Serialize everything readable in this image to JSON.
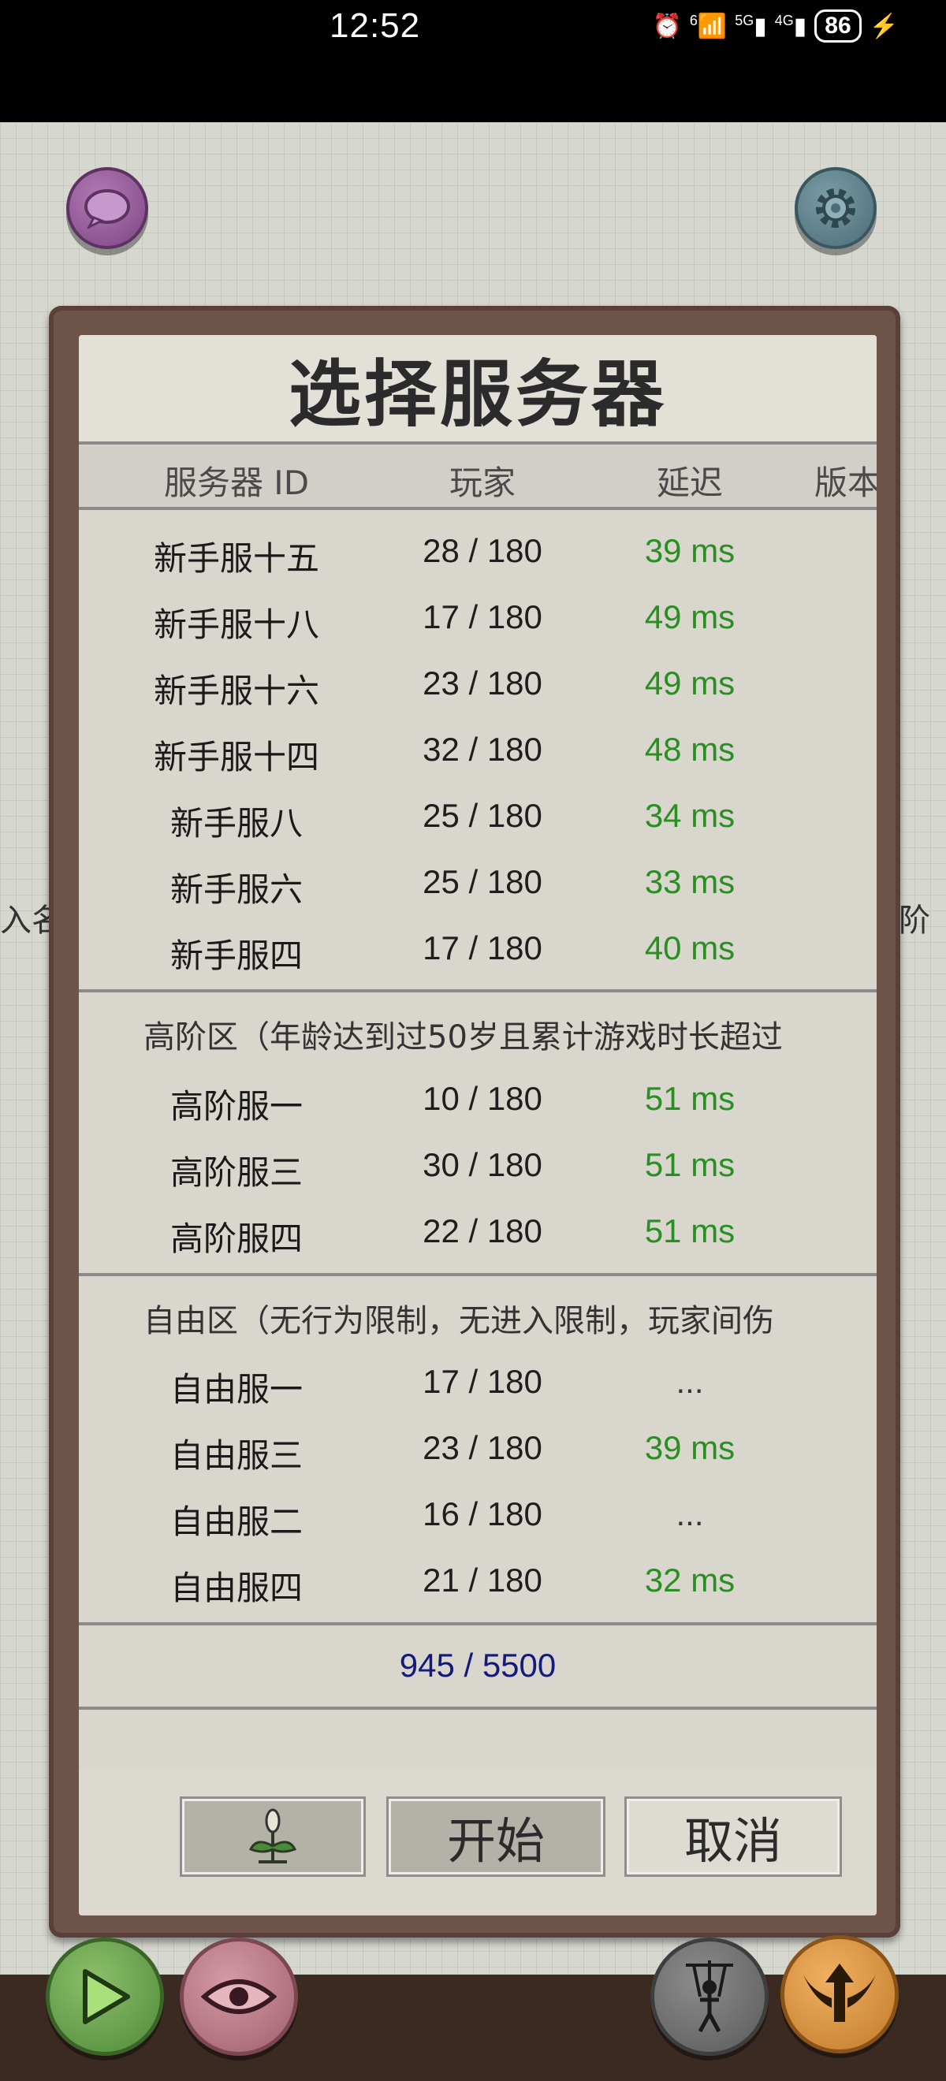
{
  "status_bar": {
    "time": "12:52",
    "net1": "6",
    "net2": "5G",
    "net3": "4G",
    "battery": "86"
  },
  "background": {
    "left_text": "入名字",
    "right_text": "阶"
  },
  "dialog": {
    "title": "选择服务器",
    "headers": {
      "id": "服务器 ID",
      "players": "玩家",
      "ping": "延迟",
      "version": "版本"
    },
    "groups": [
      {
        "label": "",
        "servers": [
          {
            "name": "新手服十五",
            "players": "28 / 180",
            "ping": "39 ms"
          },
          {
            "name": "新手服十八",
            "players": "17 / 180",
            "ping": "49 ms"
          },
          {
            "name": "新手服十六",
            "players": "23 / 180",
            "ping": "49 ms"
          },
          {
            "name": "新手服十四",
            "players": "32 / 180",
            "ping": "48 ms"
          },
          {
            "name": "新手服八",
            "players": "25 / 180",
            "ping": "34 ms"
          },
          {
            "name": "新手服六",
            "players": "25 / 180",
            "ping": "33 ms"
          },
          {
            "name": "新手服四",
            "players": "17 / 180",
            "ping": "40 ms"
          }
        ]
      },
      {
        "label": "高阶区（年龄达到过50岁且累计游戏时长超过",
        "servers": [
          {
            "name": "高阶服一",
            "players": "10 / 180",
            "ping": "51 ms"
          },
          {
            "name": "高阶服三",
            "players": "30 / 180",
            "ping": "51 ms"
          },
          {
            "name": "高阶服四",
            "players": "22 / 180",
            "ping": "51 ms"
          }
        ]
      },
      {
        "label": "自由区（无行为限制，无进入限制，玩家间伤",
        "servers": [
          {
            "name": "自由服一",
            "players": "17 / 180",
            "ping": "..."
          },
          {
            "name": "自由服三",
            "players": "23 / 180",
            "ping": "39 ms"
          },
          {
            "name": "自由服二",
            "players": "16 / 180",
            "ping": "..."
          },
          {
            "name": "自由服四",
            "players": "21 / 180",
            "ping": "32 ms"
          }
        ]
      }
    ],
    "total": "945 / 5500",
    "buttons": {
      "plant_icon": "sprout-icon",
      "start": "开始",
      "cancel": "取消"
    }
  },
  "colors": {
    "ping_green": "#2a8f22",
    "total_blue": "#141a7a",
    "frame_brown": "#6e5349"
  }
}
